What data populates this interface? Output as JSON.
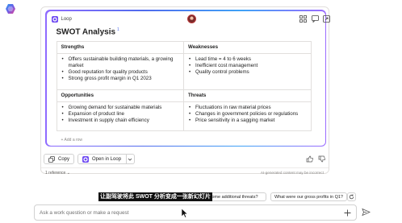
{
  "loop_card": {
    "app_name": "Loop",
    "title": "SWOT Analysis",
    "badge": "1",
    "table": {
      "headers": [
        "Strengths",
        "Weaknesses",
        "Opportunities",
        "Threats"
      ],
      "strengths": [
        "Offers sustainable building materials, a growing market",
        "Good reputation for quality products",
        "Strong gross profit margin in Q1 2023"
      ],
      "weaknesses": [
        "Lead time = 4 to 6 weeks",
        "Inefficient cost management",
        "Quality control problems"
      ],
      "opportunities": [
        "Growing demand for sustainable materials",
        "Expansion of product line",
        "Investment in supply chain efficiency"
      ],
      "threats": [
        "Fluctuations in raw material prices",
        "Changes in government policies or regulations",
        "Price sensitivity in a sagging market"
      ]
    },
    "add_row_label": "+ Add a row"
  },
  "actions": {
    "copy_label": "Copy",
    "open_label": "Open in Loop"
  },
  "footer": {
    "reference": "1 reference",
    "disclaimer": "AI-generated content may be incorrect"
  },
  "subtitle_overlay": "让副驾驶将此 SWOT 分析变成一张新幻灯片",
  "suggestions": [
    "e some additional threats?",
    "What were our gross profits in Q1?"
  ],
  "compose": {
    "placeholder": "Ask a work question or make a request"
  },
  "icons": {
    "copilot_logo": "copilot-logo-icon",
    "loop_logo": "loop-logo-icon",
    "thumb_up": "thumb-up-icon",
    "thumb_down": "thumb-down-icon",
    "send": "send-icon",
    "add": "plus-icon",
    "refresh": "refresh-icon"
  },
  "colors": {
    "accent": "#4f6bed",
    "loop_gradient_start": "#8f6bff",
    "loop_gradient_end": "#3fa2f6"
  }
}
